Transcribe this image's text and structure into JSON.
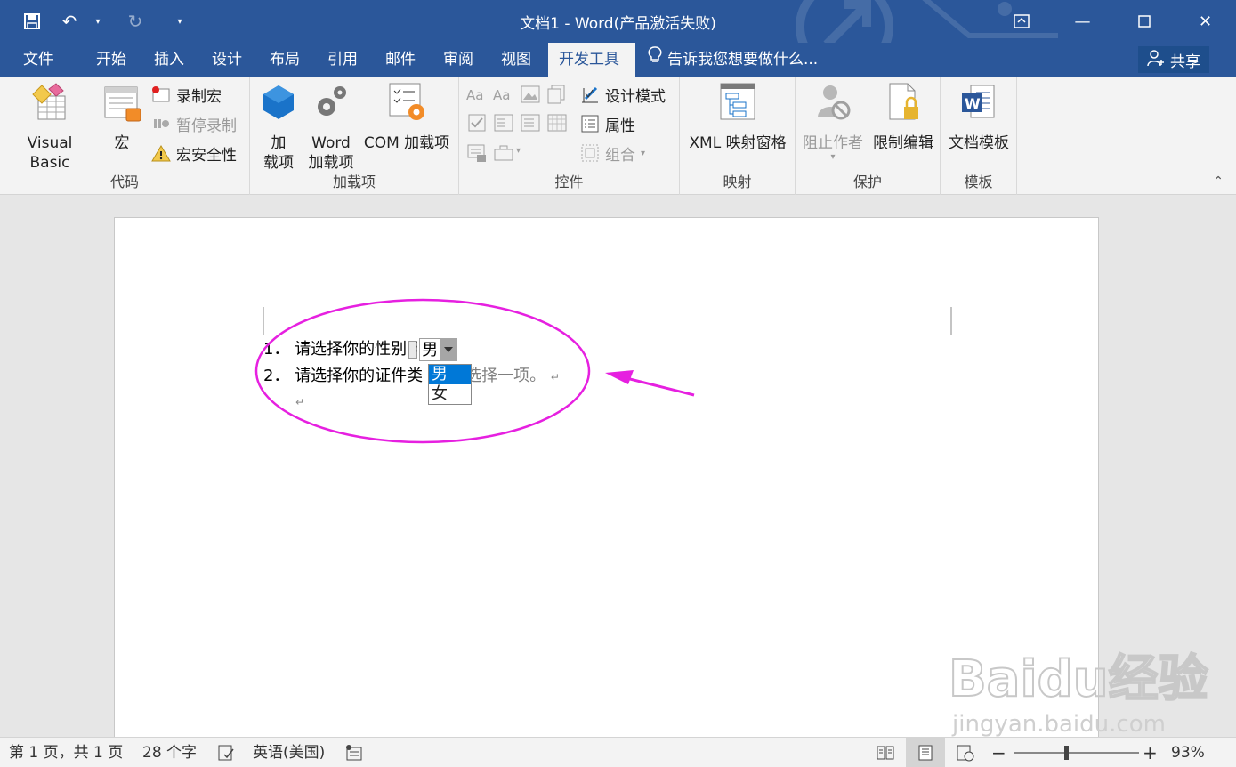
{
  "window": {
    "title": "文档1 - Word(产品激活失败)"
  },
  "tabs": [
    {
      "label": "文件"
    },
    {
      "label": "开始"
    },
    {
      "label": "插入"
    },
    {
      "label": "设计"
    },
    {
      "label": "布局"
    },
    {
      "label": "引用"
    },
    {
      "label": "邮件"
    },
    {
      "label": "审阅"
    },
    {
      "label": "视图"
    },
    {
      "label": "开发工具"
    }
  ],
  "active_tab": "开发工具",
  "tellme": {
    "placeholder": "告诉我您想要做什么..."
  },
  "share": {
    "label": "共享"
  },
  "ribbon": {
    "code": {
      "label": "代码",
      "visual_basic": "Visual Basic",
      "macro": "宏",
      "record_macro": "录制宏",
      "pause_recording": "暂停录制",
      "macro_security": "宏安全性"
    },
    "addins": {
      "label": "加载项",
      "addins_line1": "加",
      "addins_line2": "载项",
      "word_addins_line1": "Word",
      "word_addins_line2": "加载项",
      "com_addins": "COM 加载项"
    },
    "controls": {
      "label": "控件",
      "design_mode": "设计模式",
      "properties": "属性",
      "group": "组合"
    },
    "mapping": {
      "label": "映射",
      "xml_pane": "XML 映射窗格"
    },
    "protect": {
      "label": "保护",
      "block_authors": "阻止作者",
      "restrict_editing": "限制编辑"
    },
    "templates": {
      "label": "模板",
      "document_template": "文档模板"
    }
  },
  "document": {
    "line1": {
      "number": "1．",
      "text": "请选择你的性别",
      "value": "男"
    },
    "line2": {
      "number": "2．",
      "text": "请选择你的证件类",
      "placeholder": "选择一项。"
    },
    "dropdown_options": [
      "男",
      "女"
    ],
    "selected_option": "男",
    "pilcrow": "↵"
  },
  "status": {
    "page": "第 1 页，共 1 页",
    "words": "28 个字",
    "language": "英语(美国)",
    "zoom": "93%"
  },
  "watermark": {
    "brand": "Baidu经验",
    "url": "jingyan.baidu.com"
  },
  "colors": {
    "titlebar": "#2b579a",
    "ribbon": "#f3f3f3",
    "annotation": "#e620e0",
    "selection": "#0078d7"
  }
}
